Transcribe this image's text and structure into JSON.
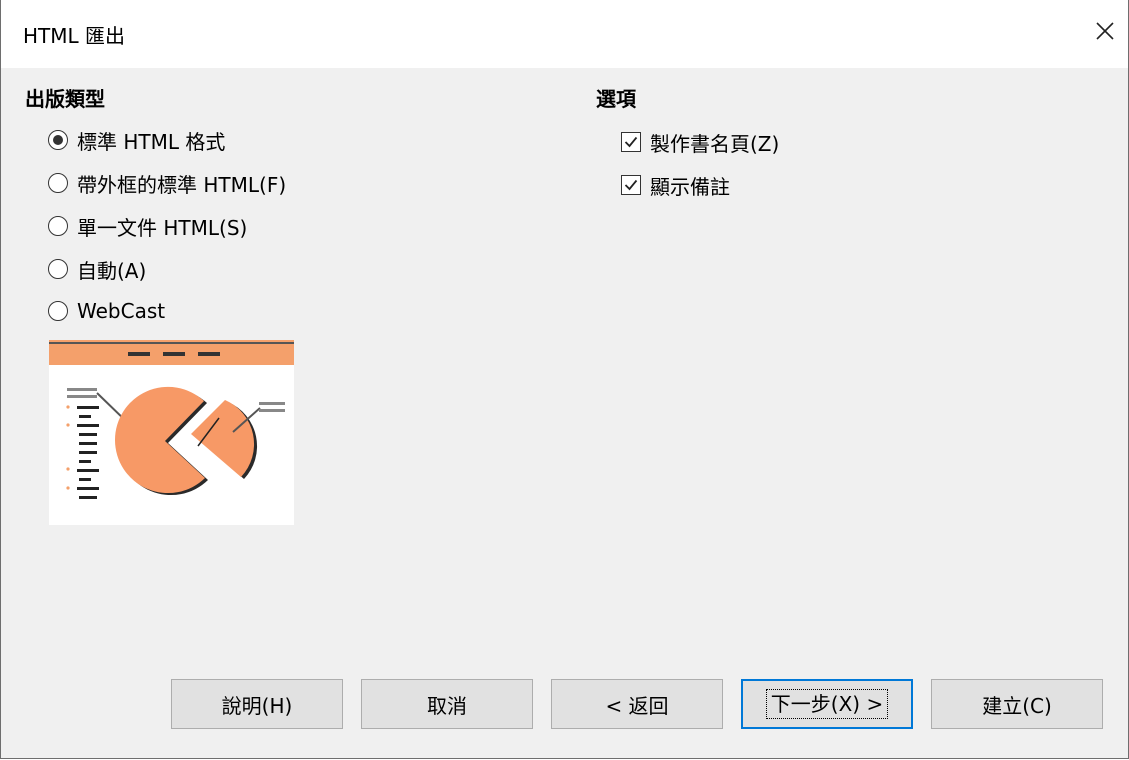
{
  "window": {
    "title": "HTML 匯出"
  },
  "publication_type": {
    "heading": "出版類型",
    "options": [
      {
        "label": "標準 HTML 格式",
        "checked": true
      },
      {
        "label": "帶外框的標準 HTML(F)",
        "checked": false
      },
      {
        "label": "單一文件 HTML(S)",
        "checked": false
      },
      {
        "label": "自動(A)",
        "checked": false
      },
      {
        "label": "WebCast",
        "checked": false
      }
    ]
  },
  "options": {
    "heading": "選項",
    "items": [
      {
        "label": "製作書名頁(Z)",
        "checked": true
      },
      {
        "label": "顯示備註",
        "checked": true
      }
    ]
  },
  "buttons": {
    "help": "說明(H)",
    "cancel": "取消",
    "back": "< 返回",
    "next": "下一步(X) >",
    "create": "建立(C)"
  },
  "colors": {
    "accent": "#f4a06b",
    "focus_border": "#0078d7"
  }
}
